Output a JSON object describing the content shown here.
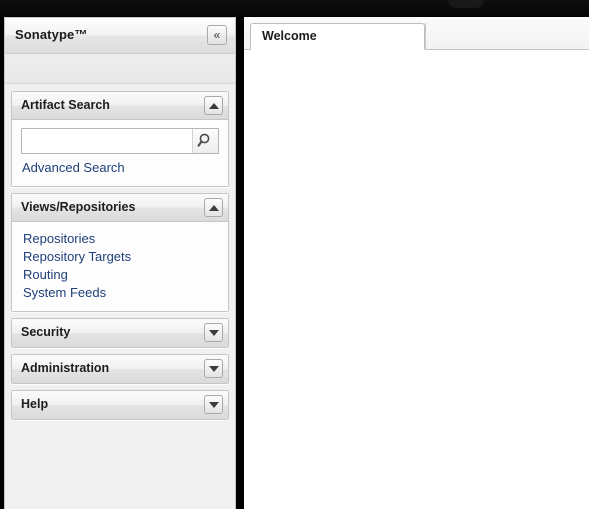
{
  "window": {
    "chrome_color": "#000000"
  },
  "sidebar": {
    "title": "Sonatype™",
    "collapse_button": {
      "icon": "double-chevron-left-icon",
      "glyph": "«"
    },
    "panels": [
      {
        "id": "artifact-search",
        "title": "Artifact Search",
        "expanded": true,
        "toggle_icon": "chevron-up-icon",
        "search": {
          "value": "",
          "placeholder": "",
          "button_icon": "search-icon"
        },
        "links": [
          {
            "label": "Advanced Search"
          }
        ]
      },
      {
        "id": "views-repositories",
        "title": "Views/Repositories",
        "expanded": true,
        "toggle_icon": "chevron-up-icon",
        "links": [
          {
            "label": "Repositories"
          },
          {
            "label": "Repository Targets"
          },
          {
            "label": "Routing"
          },
          {
            "label": "System Feeds"
          }
        ]
      },
      {
        "id": "security",
        "title": "Security",
        "expanded": false,
        "toggle_icon": "chevron-down-icon",
        "links": []
      },
      {
        "id": "administration",
        "title": "Administration",
        "expanded": false,
        "toggle_icon": "chevron-down-icon",
        "links": []
      },
      {
        "id": "help",
        "title": "Help",
        "expanded": false,
        "toggle_icon": "chevron-down-icon",
        "links": []
      }
    ]
  },
  "main": {
    "tabs": [
      {
        "label": "Welcome",
        "active": true
      }
    ],
    "content": ""
  },
  "colors": {
    "link": "#20407a",
    "panel_border": "#c6c6c6",
    "sidebar_bg": "#f0f0f0",
    "divider": "#000000",
    "content_bg": "#ffffff"
  }
}
